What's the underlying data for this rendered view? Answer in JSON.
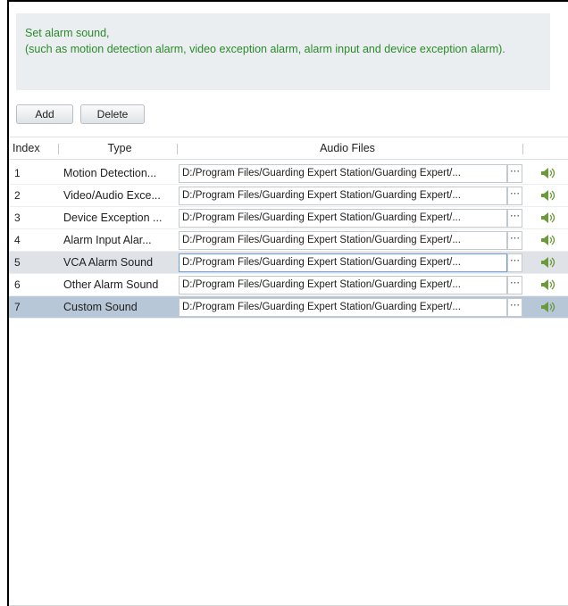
{
  "info": {
    "line1": "Set alarm sound,",
    "line2": "(such as motion detection alarm, video exception alarm, alarm input and device exception alarm)."
  },
  "toolbar": {
    "add_label": "Add",
    "delete_label": "Delete"
  },
  "table": {
    "columns": {
      "index": "Index",
      "type": "Type",
      "audio": "Audio Files"
    },
    "rows": [
      {
        "index": "1",
        "type": "Motion Detection...",
        "file": "D:/Program Files/Guarding Expert Station/Guarding Expert/...",
        "browse": "⋯"
      },
      {
        "index": "2",
        "type": "Video/Audio Exce...",
        "file": "D:/Program Files/Guarding Expert Station/Guarding Expert/...",
        "browse": "⋯"
      },
      {
        "index": "3",
        "type": "Device Exception ...",
        "file": "D:/Program Files/Guarding Expert Station/Guarding Expert/...",
        "browse": "⋯"
      },
      {
        "index": "4",
        "type": "Alarm Input Alar...",
        "file": "D:/Program Files/Guarding Expert Station/Guarding Expert/...",
        "browse": "⋯"
      },
      {
        "index": "5",
        "type": "VCA Alarm Sound",
        "file": "D:/Program Files/Guarding Expert Station/Guarding Expert/...",
        "browse": "⋯"
      },
      {
        "index": "6",
        "type": "Other Alarm Sound",
        "file": "D:/Program Files/Guarding Expert Station/Guarding Expert/...",
        "browse": "⋯"
      },
      {
        "index": "7",
        "type": "Custom Sound",
        "file": "D:/Program Files/Guarding Expert Station/Guarding Expert/...",
        "browse": "⋯"
      }
    ]
  },
  "colors": {
    "info_text": "#2a8a2a",
    "selected_row": "#b7c7d8",
    "hover_row": "#dfe3e8",
    "speaker_icon": "#6a9a3a"
  },
  "icons": {
    "play": "speaker-icon",
    "browse": "ellipsis-icon"
  }
}
